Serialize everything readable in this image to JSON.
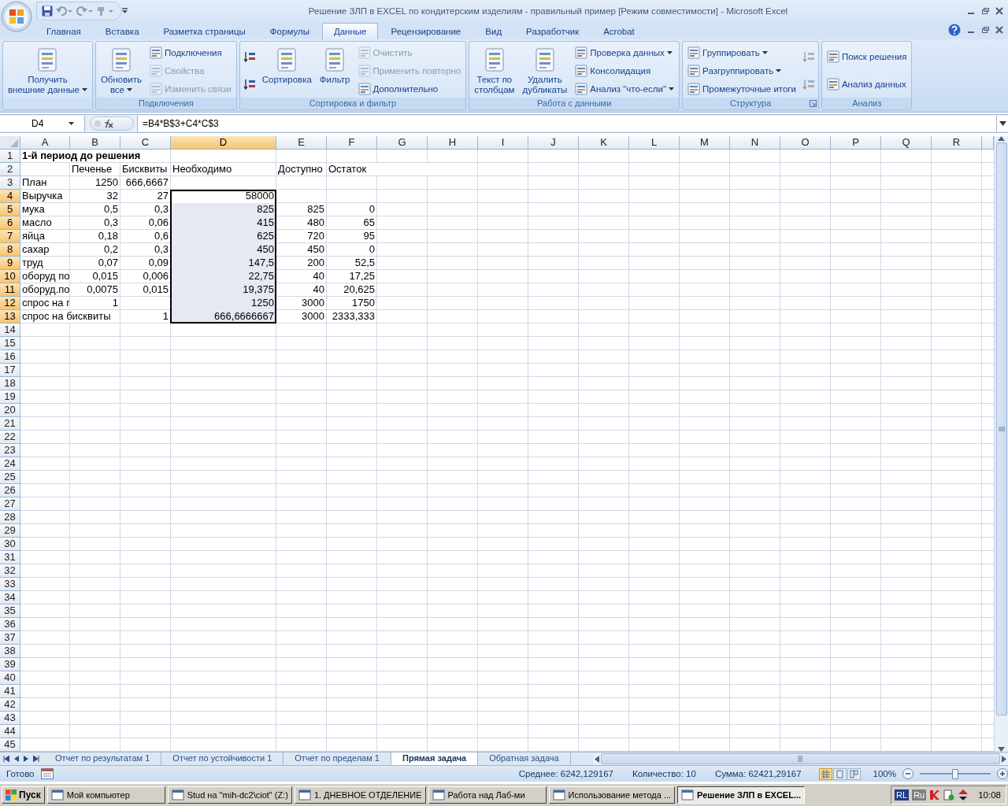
{
  "window": {
    "title": "Решение ЗЛП в EXCEL по кондитерским изделиям - правильный пример  [Режим совместимости] - Microsoft Excel"
  },
  "ribbon_tabs": [
    {
      "label": "Главная",
      "selected": false
    },
    {
      "label": "Вставка",
      "selected": false
    },
    {
      "label": "Разметка страницы",
      "selected": false
    },
    {
      "label": "Формулы",
      "selected": false
    },
    {
      "label": "Данные",
      "selected": true
    },
    {
      "label": "Рецензирование",
      "selected": false
    },
    {
      "label": "Вид",
      "selected": false
    },
    {
      "label": "Разработчик",
      "selected": false
    },
    {
      "label": "Acrobat",
      "selected": false
    }
  ],
  "ribbon_groups": [
    {
      "dialog_launcher": false,
      "items": [
        {
          "label": "Получить\nвнешние данные",
          "kind": "large",
          "dropdown": true,
          "disabled": false
        }
      ]
    },
    {
      "label": "Подключения",
      "dialog_launcher": false,
      "items": [
        {
          "label": "Обновить\nвсе",
          "kind": "large",
          "dropdown": true,
          "disabled": false
        },
        {
          "label": "Подключения",
          "kind": "small",
          "dropdown": false,
          "disabled": false
        },
        {
          "label": "Свойства",
          "kind": "small",
          "dropdown": false,
          "disabled": true
        },
        {
          "label": "Изменить связи",
          "kind": "small",
          "dropdown": false,
          "disabled": true
        }
      ]
    },
    {
      "label": "Сортировка и фильтр",
      "dialog_launcher": false,
      "items": [
        {
          "kind": "icon",
          "disabled": false
        },
        {
          "kind": "icon",
          "disabled": false
        },
        {
          "label": "Сортировка",
          "kind": "large",
          "dropdown": false,
          "disabled": false
        },
        {
          "label": "Фильтр",
          "kind": "large",
          "dropdown": false,
          "disabled": false
        },
        {
          "label": "Очистить",
          "kind": "small",
          "dropdown": false,
          "disabled": true
        },
        {
          "label": "Применить повторно",
          "kind": "small",
          "dropdown": false,
          "disabled": true
        },
        {
          "label": "Дополнительно",
          "kind": "small",
          "dropdown": false,
          "disabled": false
        }
      ]
    },
    {
      "label": "Работа с данными",
      "dialog_launcher": false,
      "items": [
        {
          "label": "Текст по\nстолбцам",
          "kind": "large",
          "dropdown": false,
          "disabled": false
        },
        {
          "label": "Удалить\nдубликаты",
          "kind": "large",
          "dropdown": false,
          "disabled": false
        },
        {
          "label": "Проверка данных",
          "kind": "small",
          "dropdown": true,
          "disabled": false
        },
        {
          "label": "Консолидация",
          "kind": "small",
          "dropdown": false,
          "disabled": false
        },
        {
          "label": "Анализ \"что-если\"",
          "kind": "small",
          "dropdown": true,
          "disabled": false
        }
      ]
    },
    {
      "label": "Структура",
      "dialog_launcher": true,
      "items": [
        {
          "label": "Группировать",
          "kind": "small",
          "dropdown": true,
          "disabled": false
        },
        {
          "label": "Разгруппировать",
          "kind": "small",
          "dropdown": true,
          "disabled": false
        },
        {
          "label": "Промежуточные итоги",
          "kind": "small",
          "dropdown": false,
          "disabled": false
        },
        {
          "kind": "icon",
          "disabled": true
        },
        {
          "kind": "icon",
          "disabled": true
        }
      ]
    },
    {
      "label": "Анализ",
      "dialog_launcher": false,
      "items": [
        {
          "label": "Поиск решения",
          "kind": "small",
          "dropdown": false,
          "disabled": false
        },
        {
          "label": "Анализ данных",
          "kind": "small",
          "dropdown": false,
          "disabled": false
        }
      ]
    }
  ],
  "formula_bar": {
    "name_box": "D4",
    "formula": "=B4*B$3+C4*C$3"
  },
  "sheet": {
    "columns": [
      {
        "letter": "A",
        "selected": false
      },
      {
        "letter": "B",
        "selected": false
      },
      {
        "letter": "C",
        "selected": false
      },
      {
        "letter": "D",
        "selected": true
      },
      {
        "letter": "E",
        "selected": false
      },
      {
        "letter": "F",
        "selected": false
      },
      {
        "letter": "G",
        "selected": false
      },
      {
        "letter": "H",
        "selected": false
      },
      {
        "letter": "I",
        "selected": false
      },
      {
        "letter": "J",
        "selected": false
      },
      {
        "letter": "K",
        "selected": false
      },
      {
        "letter": "L",
        "selected": false
      },
      {
        "letter": "M",
        "selected": false
      },
      {
        "letter": "N",
        "selected": false
      },
      {
        "letter": "O",
        "selected": false
      },
      {
        "letter": "P",
        "selected": false
      },
      {
        "letter": "Q",
        "selected": false
      },
      {
        "letter": "R",
        "selected": false
      }
    ],
    "rows": [
      {
        "number": "1",
        "selected": false,
        "cells": [
          {
            "text": "1-й период до решения",
            "kind": "text",
            "bold": true
          }
        ]
      },
      {
        "number": "2",
        "selected": false,
        "cells": [
          null,
          {
            "text": "Печенье",
            "kind": "text"
          },
          {
            "text": "Бисквиты",
            "kind": "text"
          },
          {
            "text": "Необходимо",
            "kind": "text"
          },
          {
            "text": "Доступно",
            "kind": "text"
          },
          {
            "text": "Остаток",
            "kind": "text"
          }
        ]
      },
      {
        "number": "3",
        "selected": false,
        "cells": [
          {
            "text": "План",
            "kind": "text"
          },
          {
            "text": "1250",
            "kind": "number"
          },
          {
            "text": "666,6667",
            "kind": "number"
          }
        ]
      },
      {
        "number": "4",
        "selected": true,
        "cells": [
          {
            "text": "Выручка",
            "kind": "text"
          },
          {
            "text": "32",
            "kind": "number"
          },
          {
            "text": "27",
            "kind": "number"
          },
          {
            "text": "58000",
            "kind": "number"
          }
        ]
      },
      {
        "number": "5",
        "selected": true,
        "cells": [
          {
            "text": "мука",
            "kind": "text"
          },
          {
            "text": "0,5",
            "kind": "number"
          },
          {
            "text": "0,3",
            "kind": "number"
          },
          {
            "text": "825",
            "kind": "number"
          },
          {
            "text": "825",
            "kind": "number"
          },
          {
            "text": "0",
            "kind": "number"
          }
        ]
      },
      {
        "number": "6",
        "selected": true,
        "cells": [
          {
            "text": "масло",
            "kind": "text"
          },
          {
            "text": "0,3",
            "kind": "number"
          },
          {
            "text": "0,06",
            "kind": "number"
          },
          {
            "text": "415",
            "kind": "number"
          },
          {
            "text": "480",
            "kind": "number"
          },
          {
            "text": "65",
            "kind": "number"
          }
        ]
      },
      {
        "number": "7",
        "selected": true,
        "cells": [
          {
            "text": "яйца",
            "kind": "text"
          },
          {
            "text": "0,18",
            "kind": "number"
          },
          {
            "text": "0,6",
            "kind": "number"
          },
          {
            "text": "625",
            "kind": "number"
          },
          {
            "text": "720",
            "kind": "number"
          },
          {
            "text": "95",
            "kind": "number"
          }
        ]
      },
      {
        "number": "8",
        "selected": true,
        "cells": [
          {
            "text": "сахар",
            "kind": "text"
          },
          {
            "text": "0,2",
            "kind": "number"
          },
          {
            "text": "0,3",
            "kind": "number"
          },
          {
            "text": "450",
            "kind": "number"
          },
          {
            "text": "450",
            "kind": "number"
          },
          {
            "text": "0",
            "kind": "number"
          }
        ]
      },
      {
        "number": "9",
        "selected": true,
        "cells": [
          {
            "text": "труд",
            "kind": "text"
          },
          {
            "text": "0,07",
            "kind": "number"
          },
          {
            "text": "0,09",
            "kind": "number"
          },
          {
            "text": "147,5",
            "kind": "number"
          },
          {
            "text": "200",
            "kind": "number"
          },
          {
            "text": "52,5",
            "kind": "number"
          }
        ]
      },
      {
        "number": "10",
        "selected": true,
        "cells": [
          {
            "text": "оборуд по",
            "kind": "text"
          },
          {
            "text": "0,015",
            "kind": "number"
          },
          {
            "text": "0,006",
            "kind": "number"
          },
          {
            "text": "22,75",
            "kind": "number"
          },
          {
            "text": "40",
            "kind": "number"
          },
          {
            "text": "17,25",
            "kind": "number"
          }
        ]
      },
      {
        "number": "11",
        "selected": true,
        "cells": [
          {
            "text": "оборуд.по",
            "kind": "text"
          },
          {
            "text": "0,0075",
            "kind": "number"
          },
          {
            "text": "0,015",
            "kind": "number"
          },
          {
            "text": "19,375",
            "kind": "number"
          },
          {
            "text": "40",
            "kind": "number"
          },
          {
            "text": "20,625",
            "kind": "number"
          }
        ]
      },
      {
        "number": "12",
        "selected": true,
        "cells": [
          {
            "text": "спрос на г",
            "kind": "text"
          },
          {
            "text": "1",
            "kind": "number"
          },
          null,
          {
            "text": "1250",
            "kind": "number"
          },
          {
            "text": "3000",
            "kind": "number"
          },
          {
            "text": "1750",
            "kind": "number"
          }
        ]
      },
      {
        "number": "13",
        "selected": true,
        "cells": [
          {
            "text": "спрос на бисквиты",
            "kind": "text"
          },
          null,
          {
            "text": "1",
            "kind": "number"
          },
          {
            "text": "666,6666667",
            "kind": "number"
          },
          {
            "text": "3000",
            "kind": "number"
          },
          {
            "text": "2333,333",
            "kind": "number"
          }
        ]
      },
      {
        "number": "14",
        "selected": false
      },
      {
        "number": "15",
        "selected": false
      },
      {
        "number": "16",
        "selected": false
      },
      {
        "number": "17",
        "selected": false
      },
      {
        "number": "18",
        "selected": false
      },
      {
        "number": "19",
        "selected": false
      },
      {
        "number": "20",
        "selected": false
      },
      {
        "number": "21",
        "selected": false
      },
      {
        "number": "22",
        "selected": false
      },
      {
        "number": "23",
        "selected": false
      },
      {
        "number": "24",
        "selected": false
      },
      {
        "number": "25",
        "selected": false
      },
      {
        "number": "26",
        "selected": false
      },
      {
        "number": "27",
        "selected": false
      },
      {
        "number": "28",
        "selected": false
      },
      {
        "number": "29",
        "selected": false
      },
      {
        "number": "30",
        "selected": false
      },
      {
        "number": "31",
        "selected": false
      },
      {
        "number": "32",
        "selected": false
      },
      {
        "number": "33",
        "selected": false
      },
      {
        "number": "34",
        "selected": false
      },
      {
        "number": "35",
        "selected": false
      },
      {
        "number": "36",
        "selected": false
      },
      {
        "number": "37",
        "selected": false
      },
      {
        "number": "38",
        "selected": false
      },
      {
        "number": "39",
        "selected": false
      },
      {
        "number": "40",
        "selected": false
      },
      {
        "number": "41",
        "selected": false
      },
      {
        "number": "42",
        "selected": false
      },
      {
        "number": "43",
        "selected": false
      },
      {
        "number": "44",
        "selected": false
      },
      {
        "number": "45",
        "selected": false
      }
    ]
  },
  "sheet_tabs": [
    {
      "label": "Отчет по результатам 1",
      "selected": false
    },
    {
      "label": "Отчет по устойчивости 1",
      "selected": false
    },
    {
      "label": "Отчет по пределам 1",
      "selected": false
    },
    {
      "label": "Прямая задача",
      "selected": true
    },
    {
      "label": "Обратная задача",
      "selected": false
    }
  ],
  "status_bar": {
    "state": "Готово",
    "average": "Среднее: 6242,129167",
    "count": "Количество: 10",
    "sum": "Сумма: 62421,29167",
    "views": [
      {
        "selected": true
      },
      {
        "selected": false
      },
      {
        "selected": false
      }
    ],
    "zoom": "100%",
    "zoom_slider": {
      "level": 0.5
    }
  },
  "taskbar": {
    "start": "Пуск",
    "items": [
      {
        "label": "Мой компьютер",
        "selected": false
      },
      {
        "label": "Stud на \"mih-dc2\\ciot\" (Z:)",
        "selected": false
      },
      {
        "label": "1. ДНЕВНОЕ ОТДЕЛЕНИЕ",
        "selected": false
      },
      {
        "label": "Работа над Лаб-ми",
        "selected": false
      },
      {
        "label": "Использование метода ...",
        "selected": false
      },
      {
        "label": "Решение ЗЛП в EXCEL...",
        "selected": true
      }
    ],
    "indicators": [
      "RL",
      "Ru"
    ],
    "clock": "10:08"
  }
}
